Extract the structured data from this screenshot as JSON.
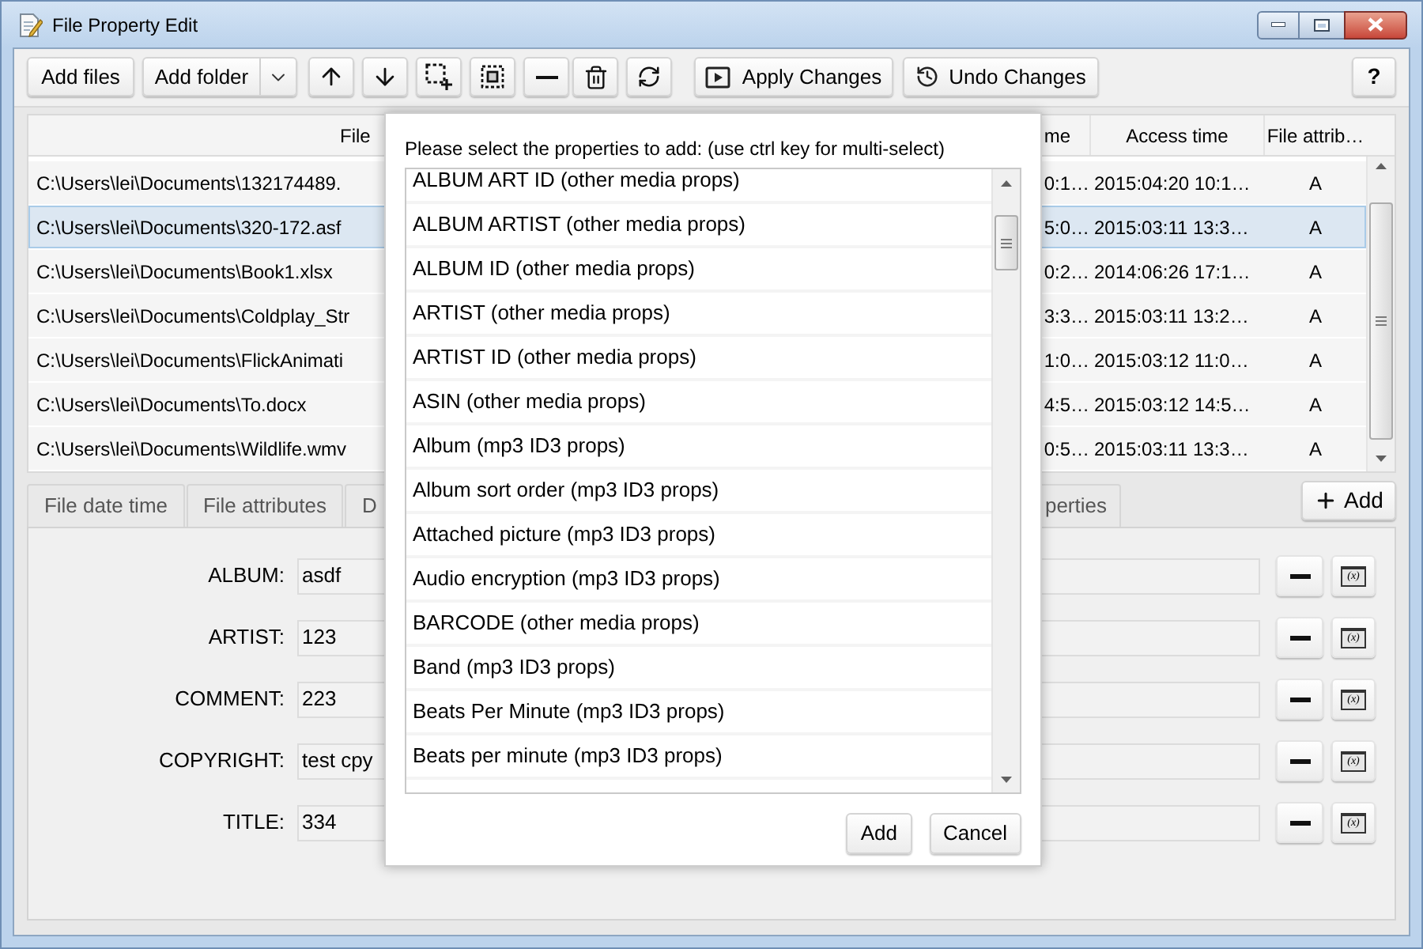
{
  "window": {
    "title": "File Property Edit"
  },
  "toolbar": {
    "add_files": "Add files",
    "add_folder": "Add folder",
    "apply": "Apply Changes",
    "undo": "Undo Changes",
    "help": "?"
  },
  "table": {
    "columns": [
      "File",
      "me",
      "Access time",
      "File attrib…"
    ],
    "rows": [
      {
        "cells": [
          "C:\\Users\\lei\\Documents\\132174489.",
          "0:1…",
          "2015:04:20 10:1…",
          "A"
        ],
        "selected": false
      },
      {
        "cells": [
          "C:\\Users\\lei\\Documents\\320-172.asf",
          "5:0…",
          "2015:03:11 13:3…",
          "A"
        ],
        "selected": true
      },
      {
        "cells": [
          "C:\\Users\\lei\\Documents\\Book1.xlsx",
          "0:2…",
          "2014:06:26 17:1…",
          "A"
        ],
        "selected": false
      },
      {
        "cells": [
          "C:\\Users\\lei\\Documents\\Coldplay_Str",
          "3:3…",
          "2015:03:11 13:2…",
          "A"
        ],
        "selected": false
      },
      {
        "cells": [
          "C:\\Users\\lei\\Documents\\FlickAnimati",
          "1:0…",
          "2015:03:12 11:0…",
          "A"
        ],
        "selected": false
      },
      {
        "cells": [
          "C:\\Users\\lei\\Documents\\To.docx",
          "4:5…",
          "2015:03:12 14:5…",
          "A"
        ],
        "selected": false
      },
      {
        "cells": [
          "C:\\Users\\lei\\Documents\\Wildlife.wmv",
          "0:5…",
          "2015:03:11 13:3…",
          "A"
        ],
        "selected": false
      }
    ]
  },
  "tabs": [
    {
      "label": "File date time",
      "selected": false
    },
    {
      "label": "File attributes",
      "selected": false
    },
    {
      "label": "D",
      "selected": false
    },
    {
      "label": "perties",
      "selected": false
    }
  ],
  "add_button": "Add",
  "properties": [
    {
      "label": "ALBUM:",
      "value": "asdf",
      "variable_button": "(x)"
    },
    {
      "label": "ARTIST:",
      "value": "123",
      "variable_button": "(x)"
    },
    {
      "label": "COMMENT:",
      "value": "223",
      "variable_button": "(x)"
    },
    {
      "label": "COPYRIGHT:",
      "value": "test cpy",
      "variable_button": "(x)"
    },
    {
      "label": "TITLE:",
      "value": "334",
      "variable_button": "(x)"
    }
  ],
  "dialog": {
    "prompt": "Please select the properties to add: (use ctrl key for multi-select)",
    "items": [
      {
        "label": "ALBUM ART ID (other media props)",
        "selected": false
      },
      {
        "label": "ALBUM ARTIST (other media props)",
        "selected": false
      },
      {
        "label": "ALBUM ID (other media props)",
        "selected": false
      },
      {
        "label": "ARTIST (other media props)",
        "selected": false
      },
      {
        "label": "ARTIST ID (other media props)",
        "selected": false
      },
      {
        "label": "ASIN (other media props)",
        "selected": false
      },
      {
        "label": "Album (mp3 ID3 props)",
        "selected": false
      },
      {
        "label": "Album sort order (mp3 ID3 props)",
        "selected": false
      },
      {
        "label": "Attached picture (mp3 ID3 props)",
        "selected": false
      },
      {
        "label": "Audio encryption (mp3 ID3 props)",
        "selected": false
      },
      {
        "label": "BARCODE (other media props)",
        "selected": false
      },
      {
        "label": "Band (mp3 ID3 props)",
        "selected": false
      },
      {
        "label": "Beats Per Minute (mp3 ID3 props)",
        "selected": false
      },
      {
        "label": "Beats per minute (mp3 ID3 props)",
        "selected": false
      }
    ],
    "buttons": [
      "Add",
      "Cancel"
    ]
  }
}
